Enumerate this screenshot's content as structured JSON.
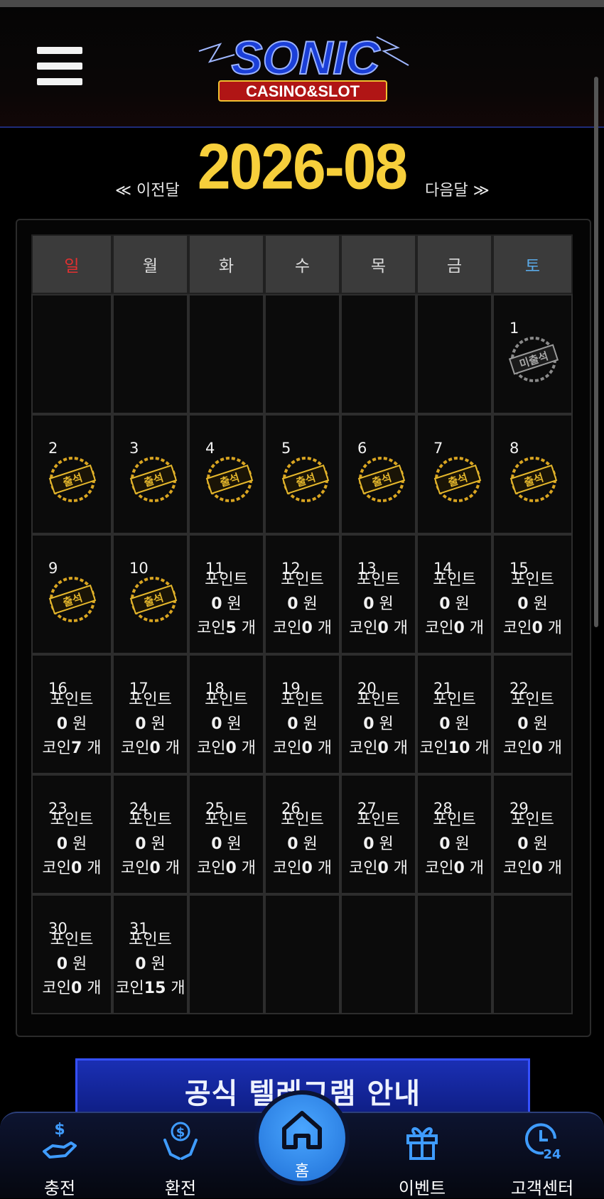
{
  "header": {
    "logo_main": "SONIC",
    "logo_sub": "CASINO&SLOT"
  },
  "month_nav": {
    "title": "2026-08",
    "prev_label": "≪ 이전달",
    "next_label": "다음달 ≫"
  },
  "calendar": {
    "weekdays": [
      "일",
      "월",
      "화",
      "수",
      "목",
      "금",
      "토"
    ],
    "stamp_present": "출석",
    "stamp_absent": "미출석",
    "point_label": "포인트",
    "won_unit": "원",
    "coin_label": "코인",
    "count_unit": "개",
    "days": {
      "d1": {
        "num": "1"
      },
      "d2": {
        "num": "2"
      },
      "d3": {
        "num": "3"
      },
      "d4": {
        "num": "4"
      },
      "d5": {
        "num": "5"
      },
      "d6": {
        "num": "6"
      },
      "d7": {
        "num": "7"
      },
      "d8": {
        "num": "8"
      },
      "d9": {
        "num": "9"
      },
      "d10": {
        "num": "10"
      },
      "d11": {
        "num": "11",
        "points": "0",
        "coins": "5"
      },
      "d12": {
        "num": "12",
        "points": "0",
        "coins": "0"
      },
      "d13": {
        "num": "13",
        "points": "0",
        "coins": "0"
      },
      "d14": {
        "num": "14",
        "points": "0",
        "coins": "0"
      },
      "d15": {
        "num": "15",
        "points": "0",
        "coins": "0"
      },
      "d16": {
        "num": "16",
        "points": "0",
        "coins": "7"
      },
      "d17": {
        "num": "17",
        "points": "0",
        "coins": "0"
      },
      "d18": {
        "num": "18",
        "points": "0",
        "coins": "0"
      },
      "d19": {
        "num": "19",
        "points": "0",
        "coins": "0"
      },
      "d20": {
        "num": "20",
        "points": "0",
        "coins": "0"
      },
      "d21": {
        "num": "21",
        "points": "0",
        "coins": "10"
      },
      "d22": {
        "num": "22",
        "points": "0",
        "coins": "0"
      },
      "d23": {
        "num": "23",
        "points": "0",
        "coins": "0"
      },
      "d24": {
        "num": "24",
        "points": "0",
        "coins": "0"
      },
      "d25": {
        "num": "25",
        "points": "0",
        "coins": "0"
      },
      "d26": {
        "num": "26",
        "points": "0",
        "coins": "0"
      },
      "d27": {
        "num": "27",
        "points": "0",
        "coins": "0"
      },
      "d28": {
        "num": "28",
        "points": "0",
        "coins": "0"
      },
      "d29": {
        "num": "29",
        "points": "0",
        "coins": "0"
      },
      "d30": {
        "num": "30",
        "points": "0",
        "coins": "0"
      },
      "d31": {
        "num": "31",
        "points": "0",
        "coins": "15"
      }
    }
  },
  "banner": {
    "title": "공식 텔레그램 안내"
  },
  "bottom_nav": {
    "deposit": "충전",
    "withdraw": "환전",
    "home": "홈",
    "event": "이벤트",
    "support": "고객센터"
  },
  "colors": {
    "accent_gold": "#f7cf3b",
    "sunday_red": "#e23030",
    "saturday_blue": "#5aa9e6",
    "nav_blue": "#3f9cff"
  }
}
